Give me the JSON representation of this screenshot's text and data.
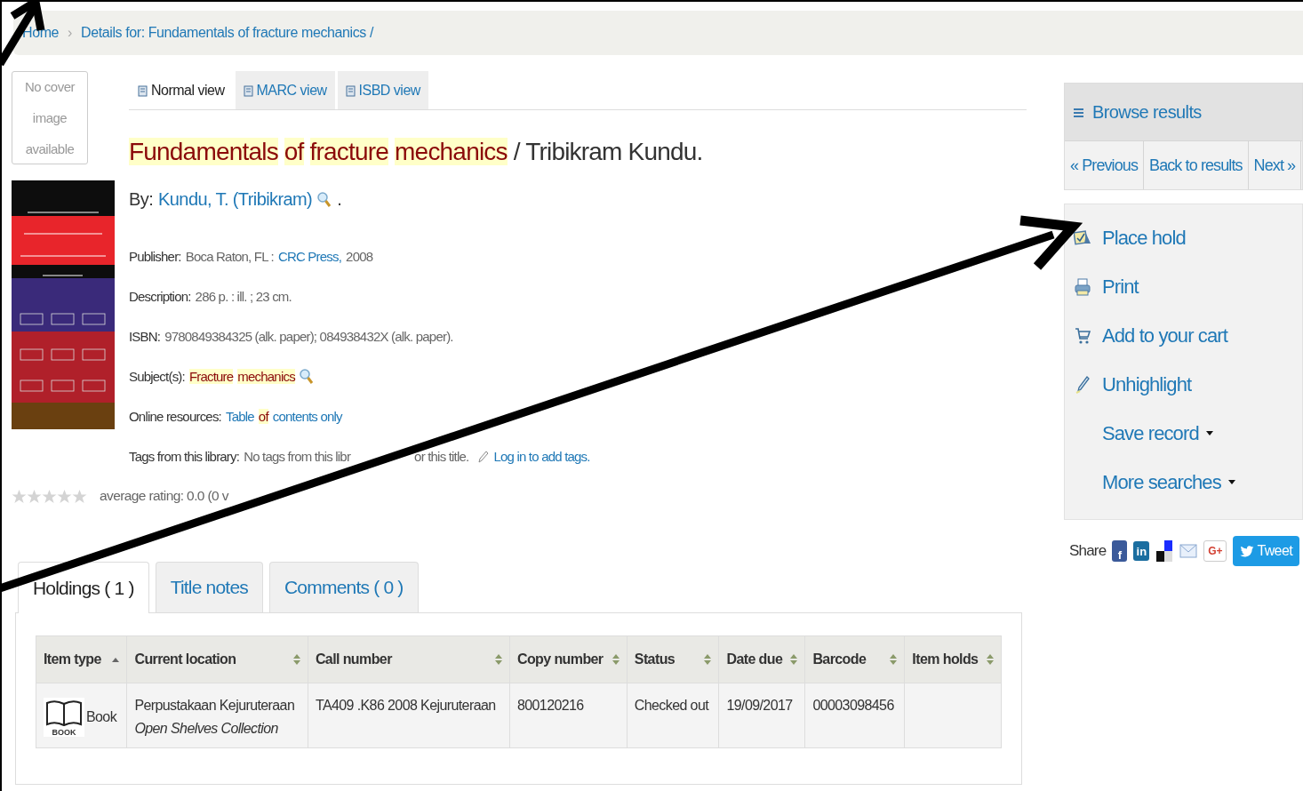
{
  "breadcrumb_separator": "›",
  "breadcrumb": [
    {
      "label": "Home"
    },
    {
      "label": "Details for: Fundamentals of fracture mechanics /"
    }
  ],
  "cover": {
    "no_cover_text": "No cover image available"
  },
  "view_tabs": [
    {
      "label": "Normal view",
      "selected": true
    },
    {
      "label": "MARC view",
      "selected": false
    },
    {
      "label": "ISBD view",
      "selected": false
    }
  ],
  "title": {
    "segments": [
      {
        "text": "Fundamentals",
        "highlighted": true
      },
      {
        "text": "of",
        "highlighted": true
      },
      {
        "text": "fracture",
        "highlighted": true
      },
      {
        "text": "mechanics",
        "highlighted": true
      }
    ],
    "responsibility": "/ Tribikram Kundu."
  },
  "author": {
    "label": "By:",
    "name": "Kundu, T. (Tribikram)",
    "end": "."
  },
  "fields": [
    {
      "label": "Publisher:",
      "parts": [
        {
          "kind": "plain",
          "text": "Boca Raton, FL :",
          "highlighted": false
        },
        {
          "kind": "link",
          "text": "CRC Press,",
          "highlighted": false
        },
        {
          "kind": "plain",
          "text": "2008",
          "highlighted": false
        }
      ]
    },
    {
      "label": "Description:",
      "parts": [
        {
          "kind": "plain",
          "text": "286 p. : ill. ; 23 cm.",
          "highlighted": false
        }
      ]
    },
    {
      "label": "ISBN:",
      "parts": [
        {
          "kind": "plain",
          "text": "9780849384325 (alk. paper); 084938432X (alk. paper).",
          "highlighted": false
        }
      ]
    },
    {
      "label": "Subject(s):",
      "parts": [
        {
          "kind": "link",
          "text": "Fracture",
          "highlighted": true
        },
        {
          "kind": "link",
          "text": "mechanics",
          "highlighted": true
        },
        {
          "kind": "search"
        }
      ]
    },
    {
      "label": "Online resources:",
      "parts": [
        {
          "kind": "link",
          "text": "Table",
          "highlighted": false
        },
        {
          "kind": "link",
          "text": "of",
          "highlighted": true
        },
        {
          "kind": "link",
          "text": "contents only",
          "highlighted": false
        }
      ]
    },
    {
      "label": "Tags from this library:",
      "parts": [
        {
          "kind": "plain",
          "text": "No tags from this libr",
          "highlighted": false
        },
        {
          "kind": "covered"
        },
        {
          "kind": "plain",
          "text": "or this title.",
          "highlighted": false
        },
        {
          "kind": "pencil"
        },
        {
          "kind": "link",
          "text": "Log in to add tags.",
          "highlighted": false
        }
      ]
    }
  ],
  "rating": {
    "stars": 0,
    "text": "average rating: 0.0 (0 v"
  },
  "holdings_tabs": [
    {
      "label": "Holdings ( 1 )",
      "selected": true
    },
    {
      "label": "Title notes",
      "selected": false
    },
    {
      "label": "Comments ( 0 )",
      "selected": false
    }
  ],
  "table": {
    "columns": [
      {
        "label": "Item type",
        "sorted_ascending": true
      },
      {
        "label": "Current location",
        "sorted_ascending": false
      },
      {
        "label": "Call number",
        "sorted_ascending": false
      },
      {
        "label": "Copy number",
        "sorted_ascending": false
      },
      {
        "label": "Status",
        "sorted_ascending": false
      },
      {
        "label": "Date due",
        "sorted_ascending": false
      },
      {
        "label": "Barcode",
        "sorted_ascending": false
      },
      {
        "label": "Item holds",
        "sorted_ascending": false
      }
    ],
    "rows": [
      {
        "item_type": {
          "icon_label": "BOOK",
          "text": "Book"
        },
        "location": {
          "name": "Perpustakaan Kejuruteraan",
          "collection": "Open Shelves Collection"
        },
        "call_number": "TA409 .K86 2008 Kejuruteraan",
        "copy_number": "800120216",
        "status": "Checked out",
        "date_due": "19/09/2017",
        "barcode": "00003098456"
      }
    ]
  },
  "browse": {
    "title": "Browse results",
    "nav": [
      "« Previous",
      "Back to results",
      "Next »"
    ]
  },
  "actions": [
    {
      "kind": "hold",
      "label": "Place hold"
    },
    {
      "kind": "print",
      "label": "Print"
    },
    {
      "kind": "cart",
      "label": "Add to your cart"
    },
    {
      "kind": "unhighlight",
      "label": "Unhighlight"
    },
    {
      "kind": "dropdown",
      "label": "Save record"
    },
    {
      "kind": "dropdown",
      "label": "More searches"
    }
  ],
  "share": {
    "label": "Share",
    "buttons": [
      {
        "kind": "facebook",
        "glyph": "f"
      },
      {
        "kind": "linkedin",
        "glyph": "in"
      },
      {
        "kind": "delicious"
      },
      {
        "kind": "email"
      },
      {
        "kind": "googleplus",
        "glyph": "G+"
      },
      {
        "kind": "tweet",
        "glyph": "Tweet"
      }
    ]
  }
}
